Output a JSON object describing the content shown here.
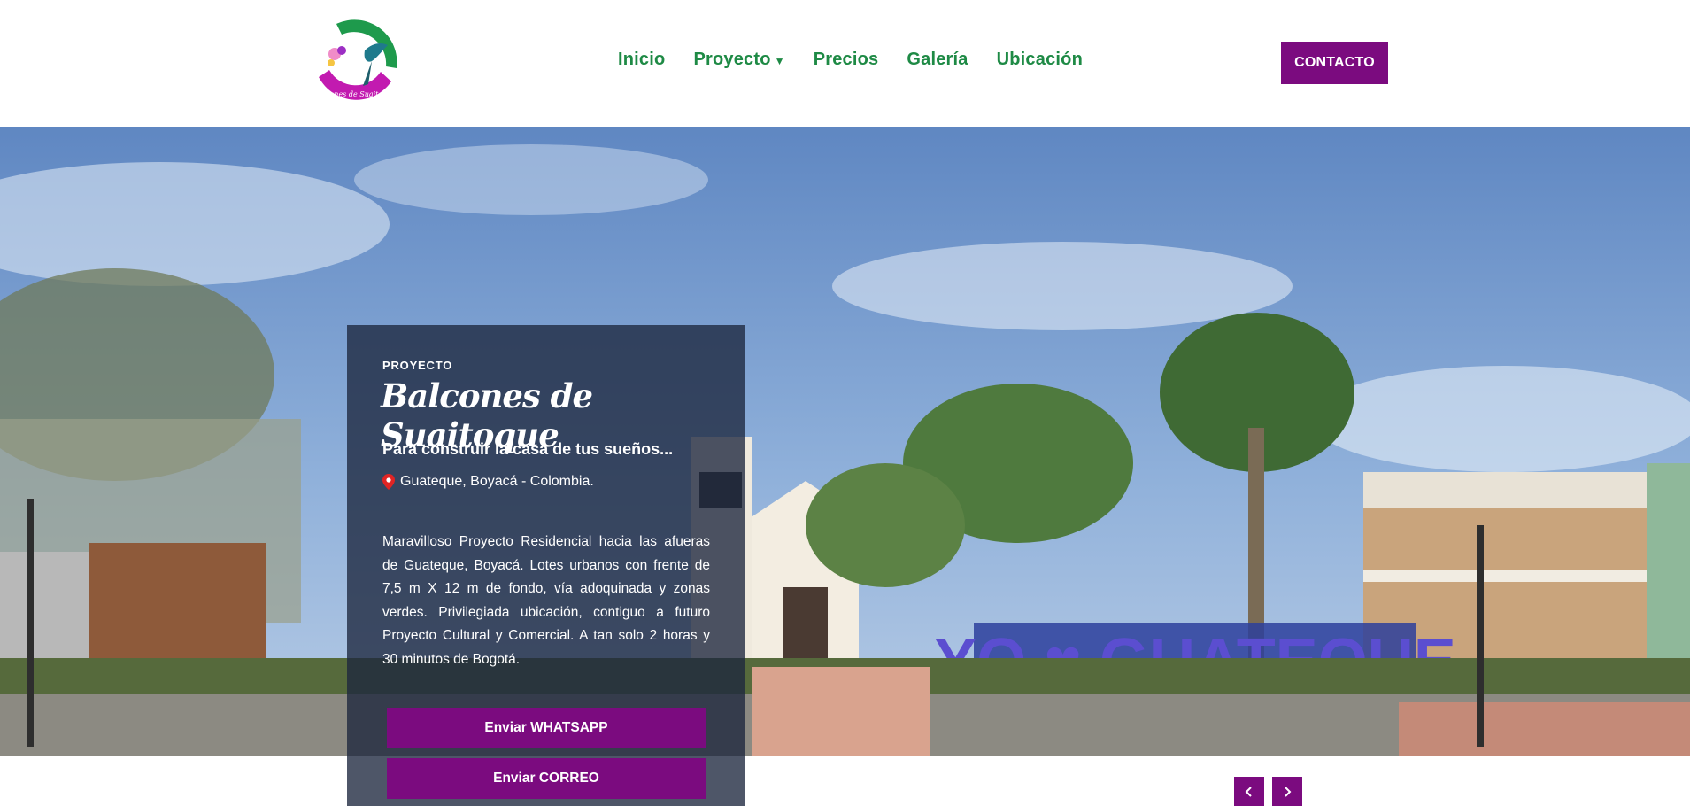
{
  "header": {
    "logo_text": "Balcones de Suaitoque",
    "nav": [
      {
        "label": "Inicio"
      },
      {
        "label": "Proyecto",
        "has_dropdown": true
      },
      {
        "label": "Precios"
      },
      {
        "label": "Galería"
      },
      {
        "label": "Ubicación"
      }
    ],
    "contact_label": "CONTACTO"
  },
  "hero": {
    "sign_text": "YO ♥ GUATEQUE",
    "card": {
      "eyebrow": "PROYECTO",
      "title": "Balcones de Suaitoque",
      "subtitle": "Para construir la casa de tus sueños...",
      "location": "Guateque, Boyacá - Colombia.",
      "description": "Maravilloso Proyecto Residencial hacia las afueras de Guateque, Boyacá. Lotes urbanos con frente de 7,5 m X 12 m de fondo, vía adoquinada y zonas verdes. Privilegiada ubicación, contiguo a futuro Proyecto Cultural y Comercial. A tan solo 2 horas y 30 minutos de Bogotá.",
      "whatsapp_label": "Enviar WHATSAPP",
      "email_label": "Enviar CORREO"
    }
  },
  "slider": {
    "prev_icon": "chevron-left-icon",
    "next_icon": "chevron-right-icon"
  },
  "colors": {
    "brand_purple": "#7b0b7f",
    "nav_green": "#1e8a45",
    "pin_red": "#e02424"
  }
}
